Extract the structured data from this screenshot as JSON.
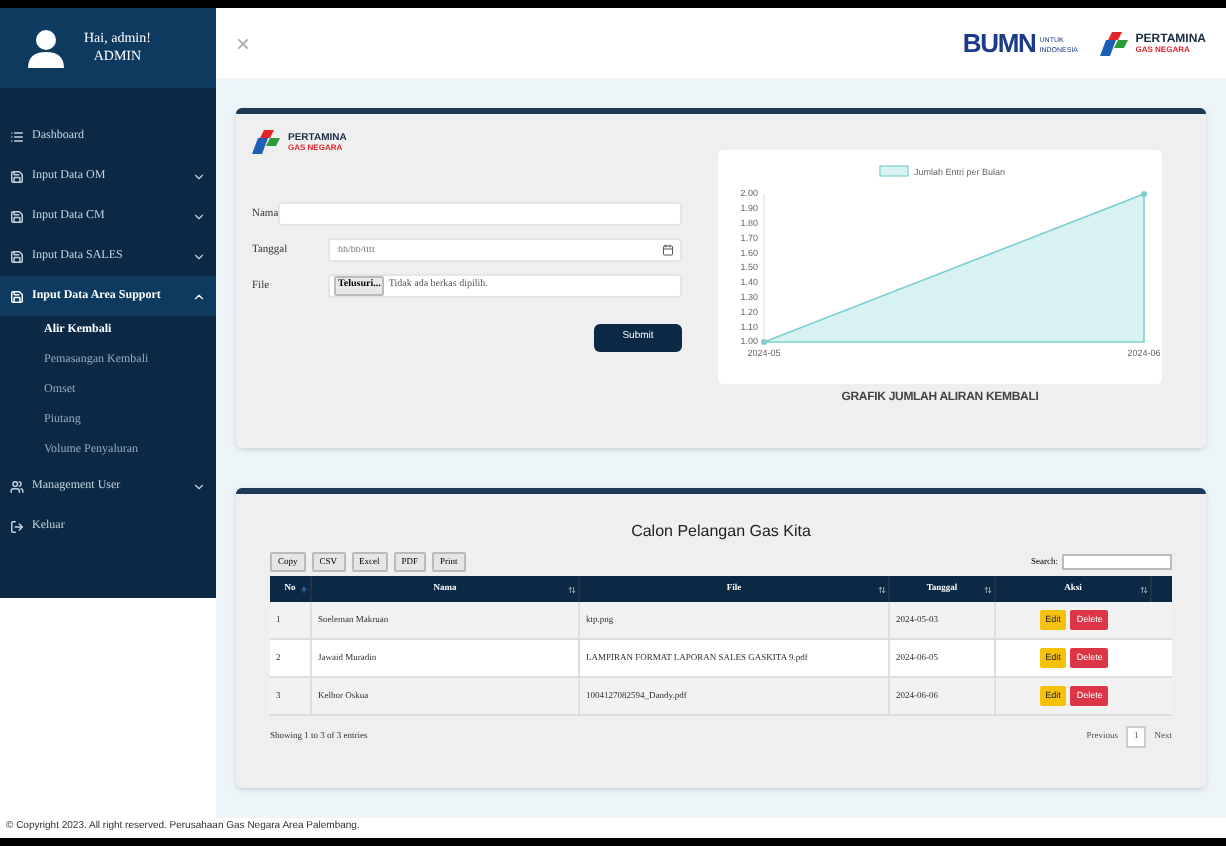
{
  "sidebar": {
    "user": {
      "greeting": "Hai, admin!",
      "role": "ADMIN"
    },
    "items": [
      {
        "kind": "link",
        "label": "Dashboard"
      },
      {
        "kind": "group",
        "label": "Input Data OM",
        "expanded": false
      },
      {
        "kind": "group",
        "label": "Input Data CM",
        "expanded": false
      },
      {
        "kind": "group",
        "label": "Input Data SALES",
        "expanded": false
      },
      {
        "kind": "group",
        "label": "Input Data Area Support",
        "expanded": true,
        "children": [
          {
            "label": "Alir Kembali",
            "selected": true
          },
          {
            "label": "Pemasangan Kembali",
            "selected": false
          },
          {
            "label": "Omset",
            "selected": false
          },
          {
            "label": "Piutang",
            "selected": false
          },
          {
            "label": "Volume Penyaluran",
            "selected": false
          }
        ]
      },
      {
        "kind": "group",
        "label": "Management User",
        "expanded": false
      },
      {
        "kind": "link",
        "label": "Keluar"
      }
    ]
  },
  "header": {
    "close": "×",
    "logos": {
      "bumn": "BUMN",
      "bumn_sub": "UNTUK INDONESIA",
      "brand": "PERTAMINA",
      "brand_sub": "GAS NEGARA"
    }
  },
  "form": {
    "logo": {
      "brand": "PERTAMINA",
      "brand_sub": "GAS NEGARA"
    },
    "fields": [
      {
        "kind": "text",
        "label": "Nama"
      },
      {
        "kind": "date",
        "label": "Tanggal",
        "placeholder": "hh/bb/tttt"
      },
      {
        "kind": "file",
        "label": "File",
        "button": "Telusuri...",
        "status": "Tidak ada berkas dipilih."
      }
    ],
    "submit": "Submit"
  },
  "chart": {
    "caption": "GRAFIK JUMLAH ALIRAN KEMBALI",
    "chart_data": {
      "type": "area",
      "categories": [
        "2024-05",
        "2024-06"
      ],
      "series": [
        {
          "name": "Jumlah Entri per Bulan",
          "color": "#7fcfcf",
          "values": [
            1,
            2
          ]
        }
      ],
      "ylim": [
        1,
        2
      ],
      "yticks": [
        {
          "value": 1,
          "label": "1.00"
        },
        {
          "value": 1.1,
          "label": "1.10"
        },
        {
          "value": 1.2,
          "label": "1.20"
        },
        {
          "value": 1.3,
          "label": "1.30"
        },
        {
          "value": 1.4,
          "label": "1.40"
        },
        {
          "value": 1.5,
          "label": "1.50"
        },
        {
          "value": 1.6,
          "label": "1.60"
        },
        {
          "value": 1.7,
          "label": "1.70"
        },
        {
          "value": 1.8,
          "label": "1.80"
        },
        {
          "value": 1.9,
          "label": "1.90"
        },
        {
          "value": 2,
          "label": "2.00"
        }
      ]
    }
  },
  "table": {
    "title": "Calon Pelangan Gas Kita",
    "export_buttons": [
      "Copy",
      "CSV",
      "Excel",
      "PDF",
      "Print"
    ],
    "search_label": "Search:",
    "columns": [
      {
        "label": "No",
        "sorted": true
      },
      {
        "label": "Nama",
        "sorted": false
      },
      {
        "label": "File",
        "sorted": false
      },
      {
        "label": "Tanggal",
        "sorted": false
      },
      {
        "label": "Aksi",
        "sorted": false
      }
    ],
    "rows": [
      {
        "no": "1",
        "name": "Soeleman Makruan",
        "file": "ktp.png",
        "date": "2024-05-03",
        "actions": [
          "Edit",
          "Delete"
        ]
      },
      {
        "no": "2",
        "name": "Jawaid Muradin",
        "file": "LAMPIRAN FORMAT LAPORAN SALES GASKITA 9.pdf",
        "date": "2024-06-05",
        "actions": [
          "Edit",
          "Delete"
        ]
      },
      {
        "no": "3",
        "name": "Kelbor Oskua",
        "file": "1004127082594_Dandy.pdf",
        "date": "2024-06-06",
        "actions": [
          "Edit",
          "Delete"
        ]
      }
    ],
    "info": "Showing 1 to 3 of 3 entries",
    "pagination": {
      "previous": "Previous",
      "pages": [
        {
          "label": "1",
          "selected": true
        }
      ],
      "next": "Next"
    }
  },
  "footer": "© Copyright 2023. All right reserved. Perusahaan Gas Negara Area Palembang."
}
